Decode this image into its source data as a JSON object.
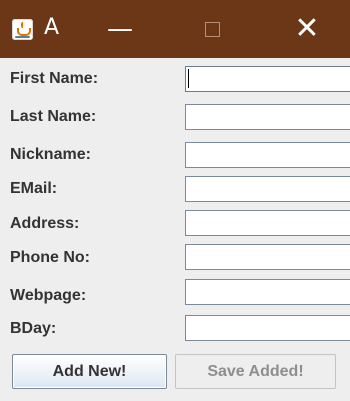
{
  "window": {
    "title": "A",
    "controls": {
      "minimize_glyph": "—",
      "close_glyph": "✕"
    },
    "colors": {
      "titlebar": "#6b3717",
      "background": "#eeeeee"
    },
    "icon": "java-cup-icon"
  },
  "form": {
    "fields": [
      {
        "label": "First Name:",
        "value": ""
      },
      {
        "label": "Last Name:",
        "value": ""
      },
      {
        "label": "Nickname:",
        "value": ""
      },
      {
        "label": "EMail:",
        "value": ""
      },
      {
        "label": "Address:",
        "value": ""
      },
      {
        "label": "Phone No:",
        "value": ""
      },
      {
        "label": "Webpage:",
        "value": ""
      },
      {
        "label": "BDay:",
        "value": ""
      }
    ]
  },
  "buttons": {
    "add_label": "Add New!",
    "save_label": "Save Added!",
    "save_enabled": false
  }
}
